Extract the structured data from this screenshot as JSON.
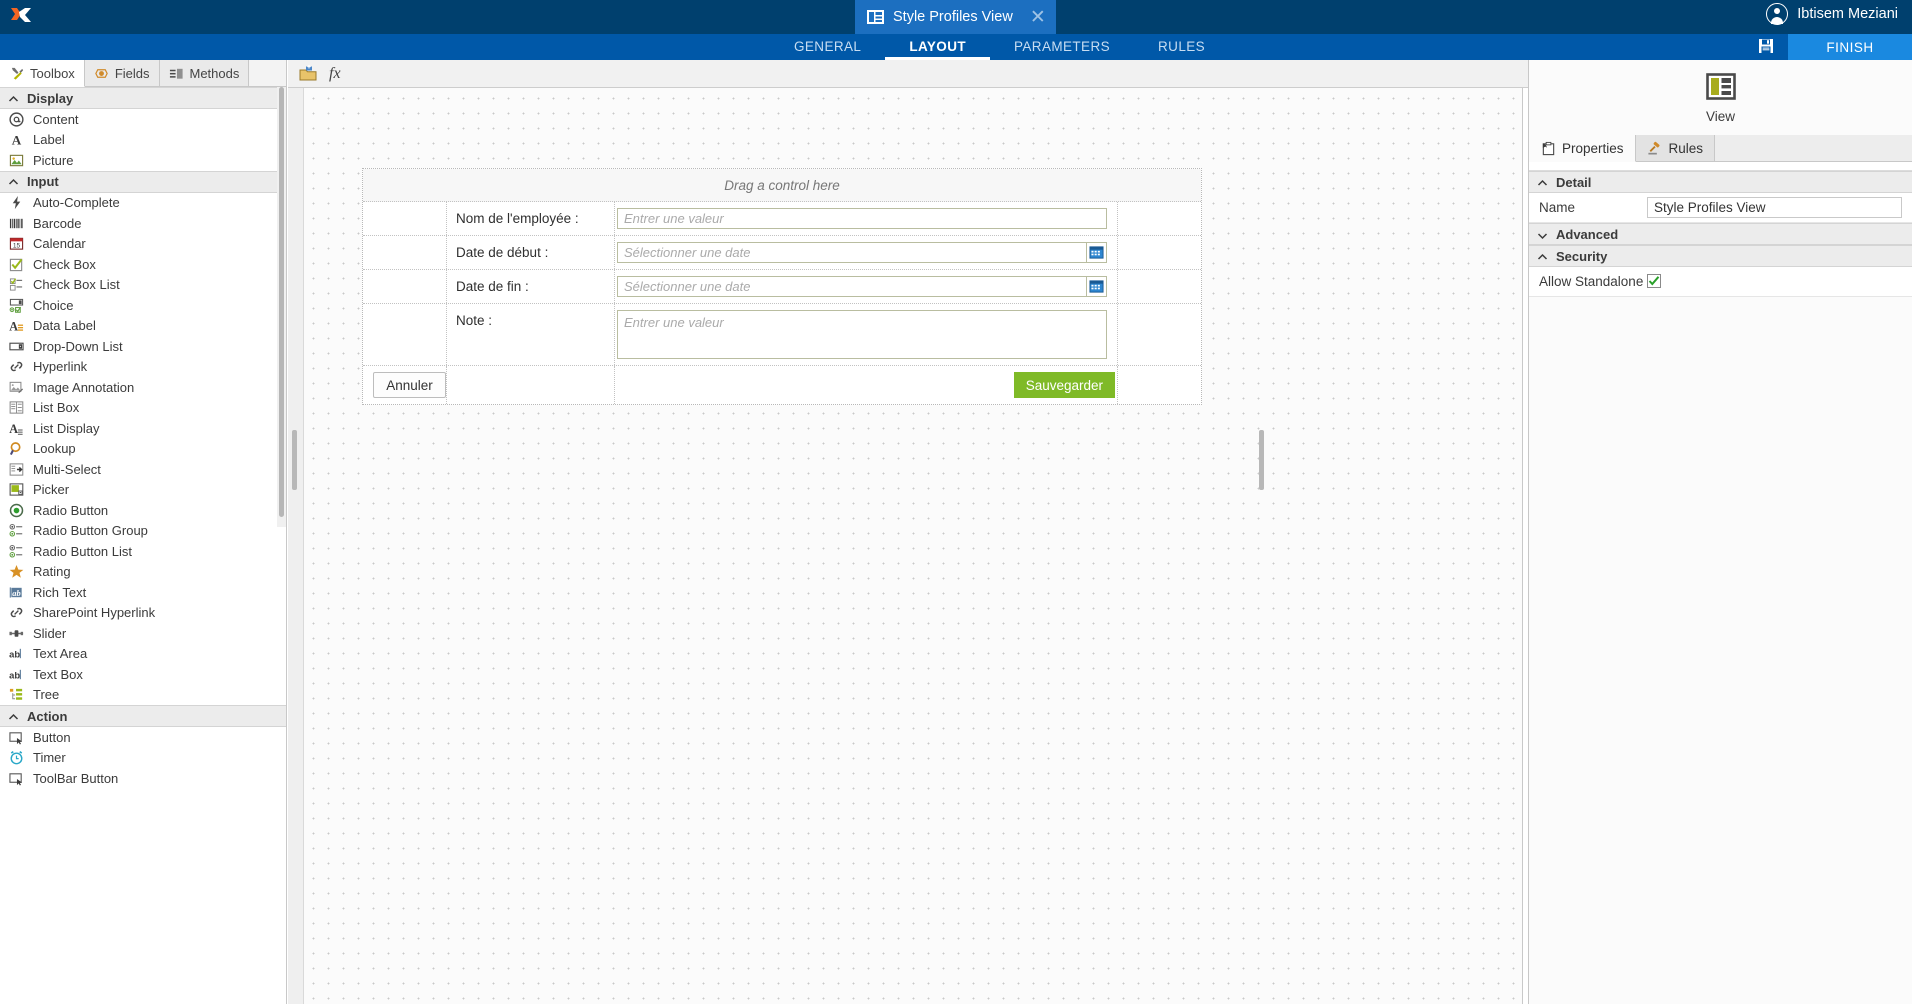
{
  "topbar": {
    "logo_icon": "x-brand-logo",
    "tab": {
      "icon": "view-layout-icon",
      "title": "Style Profiles View",
      "close_icon": "close-icon"
    },
    "user": {
      "avatar_icon": "user-avatar-icon",
      "name": "Ibtisem Meziani"
    }
  },
  "ribbon": {
    "tabs": [
      {
        "label": "GENERAL",
        "active": false
      },
      {
        "label": "LAYOUT",
        "active": true
      },
      {
        "label": "PARAMETERS",
        "active": false
      },
      {
        "label": "RULES",
        "active": false
      }
    ],
    "save_icon": "floppy-disk-save-icon",
    "finish_label": "FINISH",
    "colors": {
      "bar": "#0058a8",
      "finish": "#1a89e0",
      "topbar": "#00406e"
    }
  },
  "left_panel": {
    "tabs": [
      {
        "label": "Toolbox",
        "icon": "tools-icon",
        "active": true
      },
      {
        "label": "Fields",
        "icon": "fields-icon",
        "active": false
      },
      {
        "label": "Methods",
        "icon": "methods-icon",
        "active": false
      }
    ],
    "groups": [
      {
        "label": "Display",
        "expanded": true,
        "items": [
          {
            "label": "Content",
            "icon": "at-sign-icon"
          },
          {
            "label": "Label",
            "icon": "letter-a-icon"
          },
          {
            "label": "Picture",
            "icon": "picture-icon"
          }
        ]
      },
      {
        "label": "Input",
        "expanded": true,
        "items": [
          {
            "label": "Auto-Complete",
            "icon": "lightning-bolt-icon"
          },
          {
            "label": "Barcode",
            "icon": "barcode-icon"
          },
          {
            "label": "Calendar",
            "icon": "calendar-icon"
          },
          {
            "label": "Check Box",
            "icon": "checkbox-icon"
          },
          {
            "label": "Check Box List",
            "icon": "checkbox-list-icon"
          },
          {
            "label": "Choice",
            "icon": "choice-icon"
          },
          {
            "label": "Data Label",
            "icon": "data-label-icon"
          },
          {
            "label": "Drop-Down List",
            "icon": "dropdown-icon"
          },
          {
            "label": "Hyperlink",
            "icon": "link-icon"
          },
          {
            "label": "Image Annotation",
            "icon": "image-annotation-icon"
          },
          {
            "label": "List Box",
            "icon": "list-box-icon"
          },
          {
            "label": "List Display",
            "icon": "list-display-icon"
          },
          {
            "label": "Lookup",
            "icon": "magnifier-icon"
          },
          {
            "label": "Multi-Select",
            "icon": "multi-select-icon"
          },
          {
            "label": "Picker",
            "icon": "picker-icon"
          },
          {
            "label": "Radio Button",
            "icon": "radio-button-icon"
          },
          {
            "label": "Radio Button Group",
            "icon": "radio-group-icon"
          },
          {
            "label": "Radio Button List",
            "icon": "radio-list-icon"
          },
          {
            "label": "Rating",
            "icon": "star-icon"
          },
          {
            "label": "Rich Text",
            "icon": "rich-text-icon"
          },
          {
            "label": "SharePoint Hyperlink",
            "icon": "link-icon"
          },
          {
            "label": "Slider",
            "icon": "slider-icon"
          },
          {
            "label": "Text Area",
            "icon": "text-area-icon"
          },
          {
            "label": "Text Box",
            "icon": "text-box-icon"
          },
          {
            "label": "Tree",
            "icon": "tree-icon"
          }
        ]
      },
      {
        "label": "Action",
        "expanded": true,
        "items": [
          {
            "label": "Button",
            "icon": "button-icon"
          },
          {
            "label": "Timer",
            "icon": "timer-icon"
          },
          {
            "label": "ToolBar Button",
            "icon": "toolbar-button-icon"
          }
        ]
      }
    ]
  },
  "designer": {
    "toolbar": {
      "open_icon": "open-folder-icon",
      "fx_label": "fx"
    },
    "form": {
      "drag_hint": "Drag a control here",
      "rows": [
        {
          "label": "Nom de l'employée :",
          "control": "textbox",
          "placeholder": "Entrer une valeur"
        },
        {
          "label": "Date de début :",
          "control": "datepicker",
          "placeholder": "Sélectionner une date",
          "button_icon": "calendar-icon"
        },
        {
          "label": "Date de fin :",
          "control": "datepicker",
          "placeholder": "Sélectionner une date",
          "button_icon": "calendar-icon"
        },
        {
          "label": "Note :",
          "control": "textarea",
          "placeholder": "Entrer une valeur"
        }
      ],
      "cancel_label": "Annuler",
      "save_label": "Sauvegarder",
      "save_color": "#7fba27"
    }
  },
  "right_panel": {
    "header": {
      "icon": "view-layout-icon",
      "label": "View"
    },
    "tabs": [
      {
        "label": "Properties",
        "icon": "properties-icon",
        "active": true
      },
      {
        "label": "Rules",
        "icon": "gavel-icon",
        "active": false
      }
    ],
    "sections": [
      {
        "label": "Detail",
        "expanded": true,
        "rows": [
          {
            "name": "Name",
            "value": "Style Profiles View",
            "type": "text"
          }
        ]
      },
      {
        "label": "Advanced",
        "expanded": false,
        "rows": []
      },
      {
        "label": "Security",
        "expanded": true,
        "rows": [
          {
            "name": "Allow Standalone",
            "value": "checked",
            "type": "checkbox"
          }
        ]
      }
    ]
  }
}
